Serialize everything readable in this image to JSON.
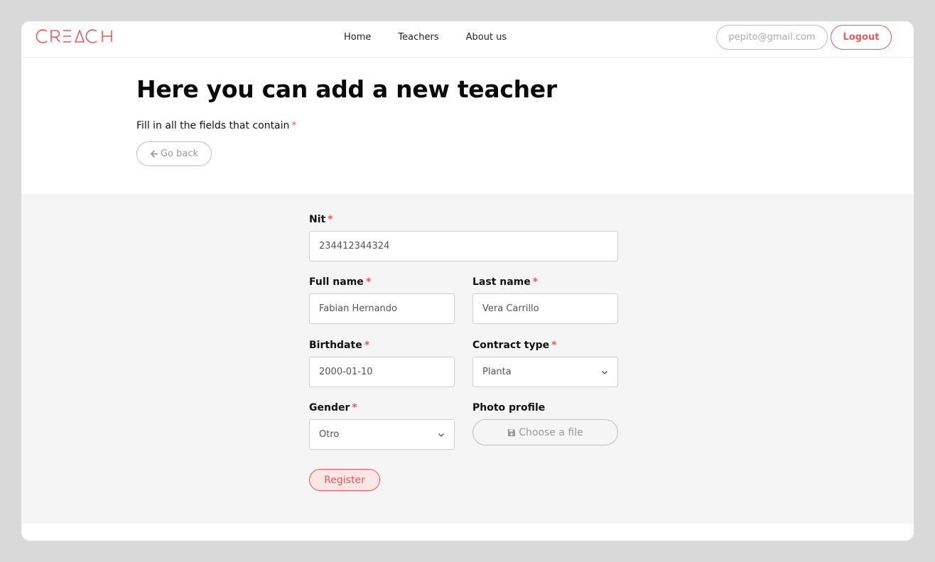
{
  "brand": {
    "logo_text": "CREACH",
    "accent": "#e25c5c"
  },
  "nav": {
    "links": [
      {
        "label": "Home"
      },
      {
        "label": "Teachers"
      },
      {
        "label": "About us"
      }
    ],
    "user_email": "pepito@gmail.com",
    "logout_label": "Logout"
  },
  "header": {
    "title": "Here you can add a new teacher",
    "subtitle": "Fill in all the fields that contain",
    "required_marker": "*",
    "go_back_label": "Go back",
    "go_back_icon": "arrow-left-icon"
  },
  "form": {
    "nit": {
      "label": "Nit",
      "value": "234412344324"
    },
    "full_name": {
      "label": "Full name",
      "value": "Fabian Hernando"
    },
    "last_name": {
      "label": "Last name",
      "value": "Vera Carrillo"
    },
    "birthdate": {
      "label": "Birthdate",
      "value": "2000-01-10"
    },
    "contract_type": {
      "label": "Contract type",
      "value": "Planta",
      "icon": "chevron-down-icon"
    },
    "gender": {
      "label": "Gender",
      "value": "Otro",
      "icon": "chevron-down-icon"
    },
    "photo_profile": {
      "label": "Photo profile",
      "button_label": "Choose a file",
      "icon": "save-icon"
    },
    "register_label": "Register"
  }
}
